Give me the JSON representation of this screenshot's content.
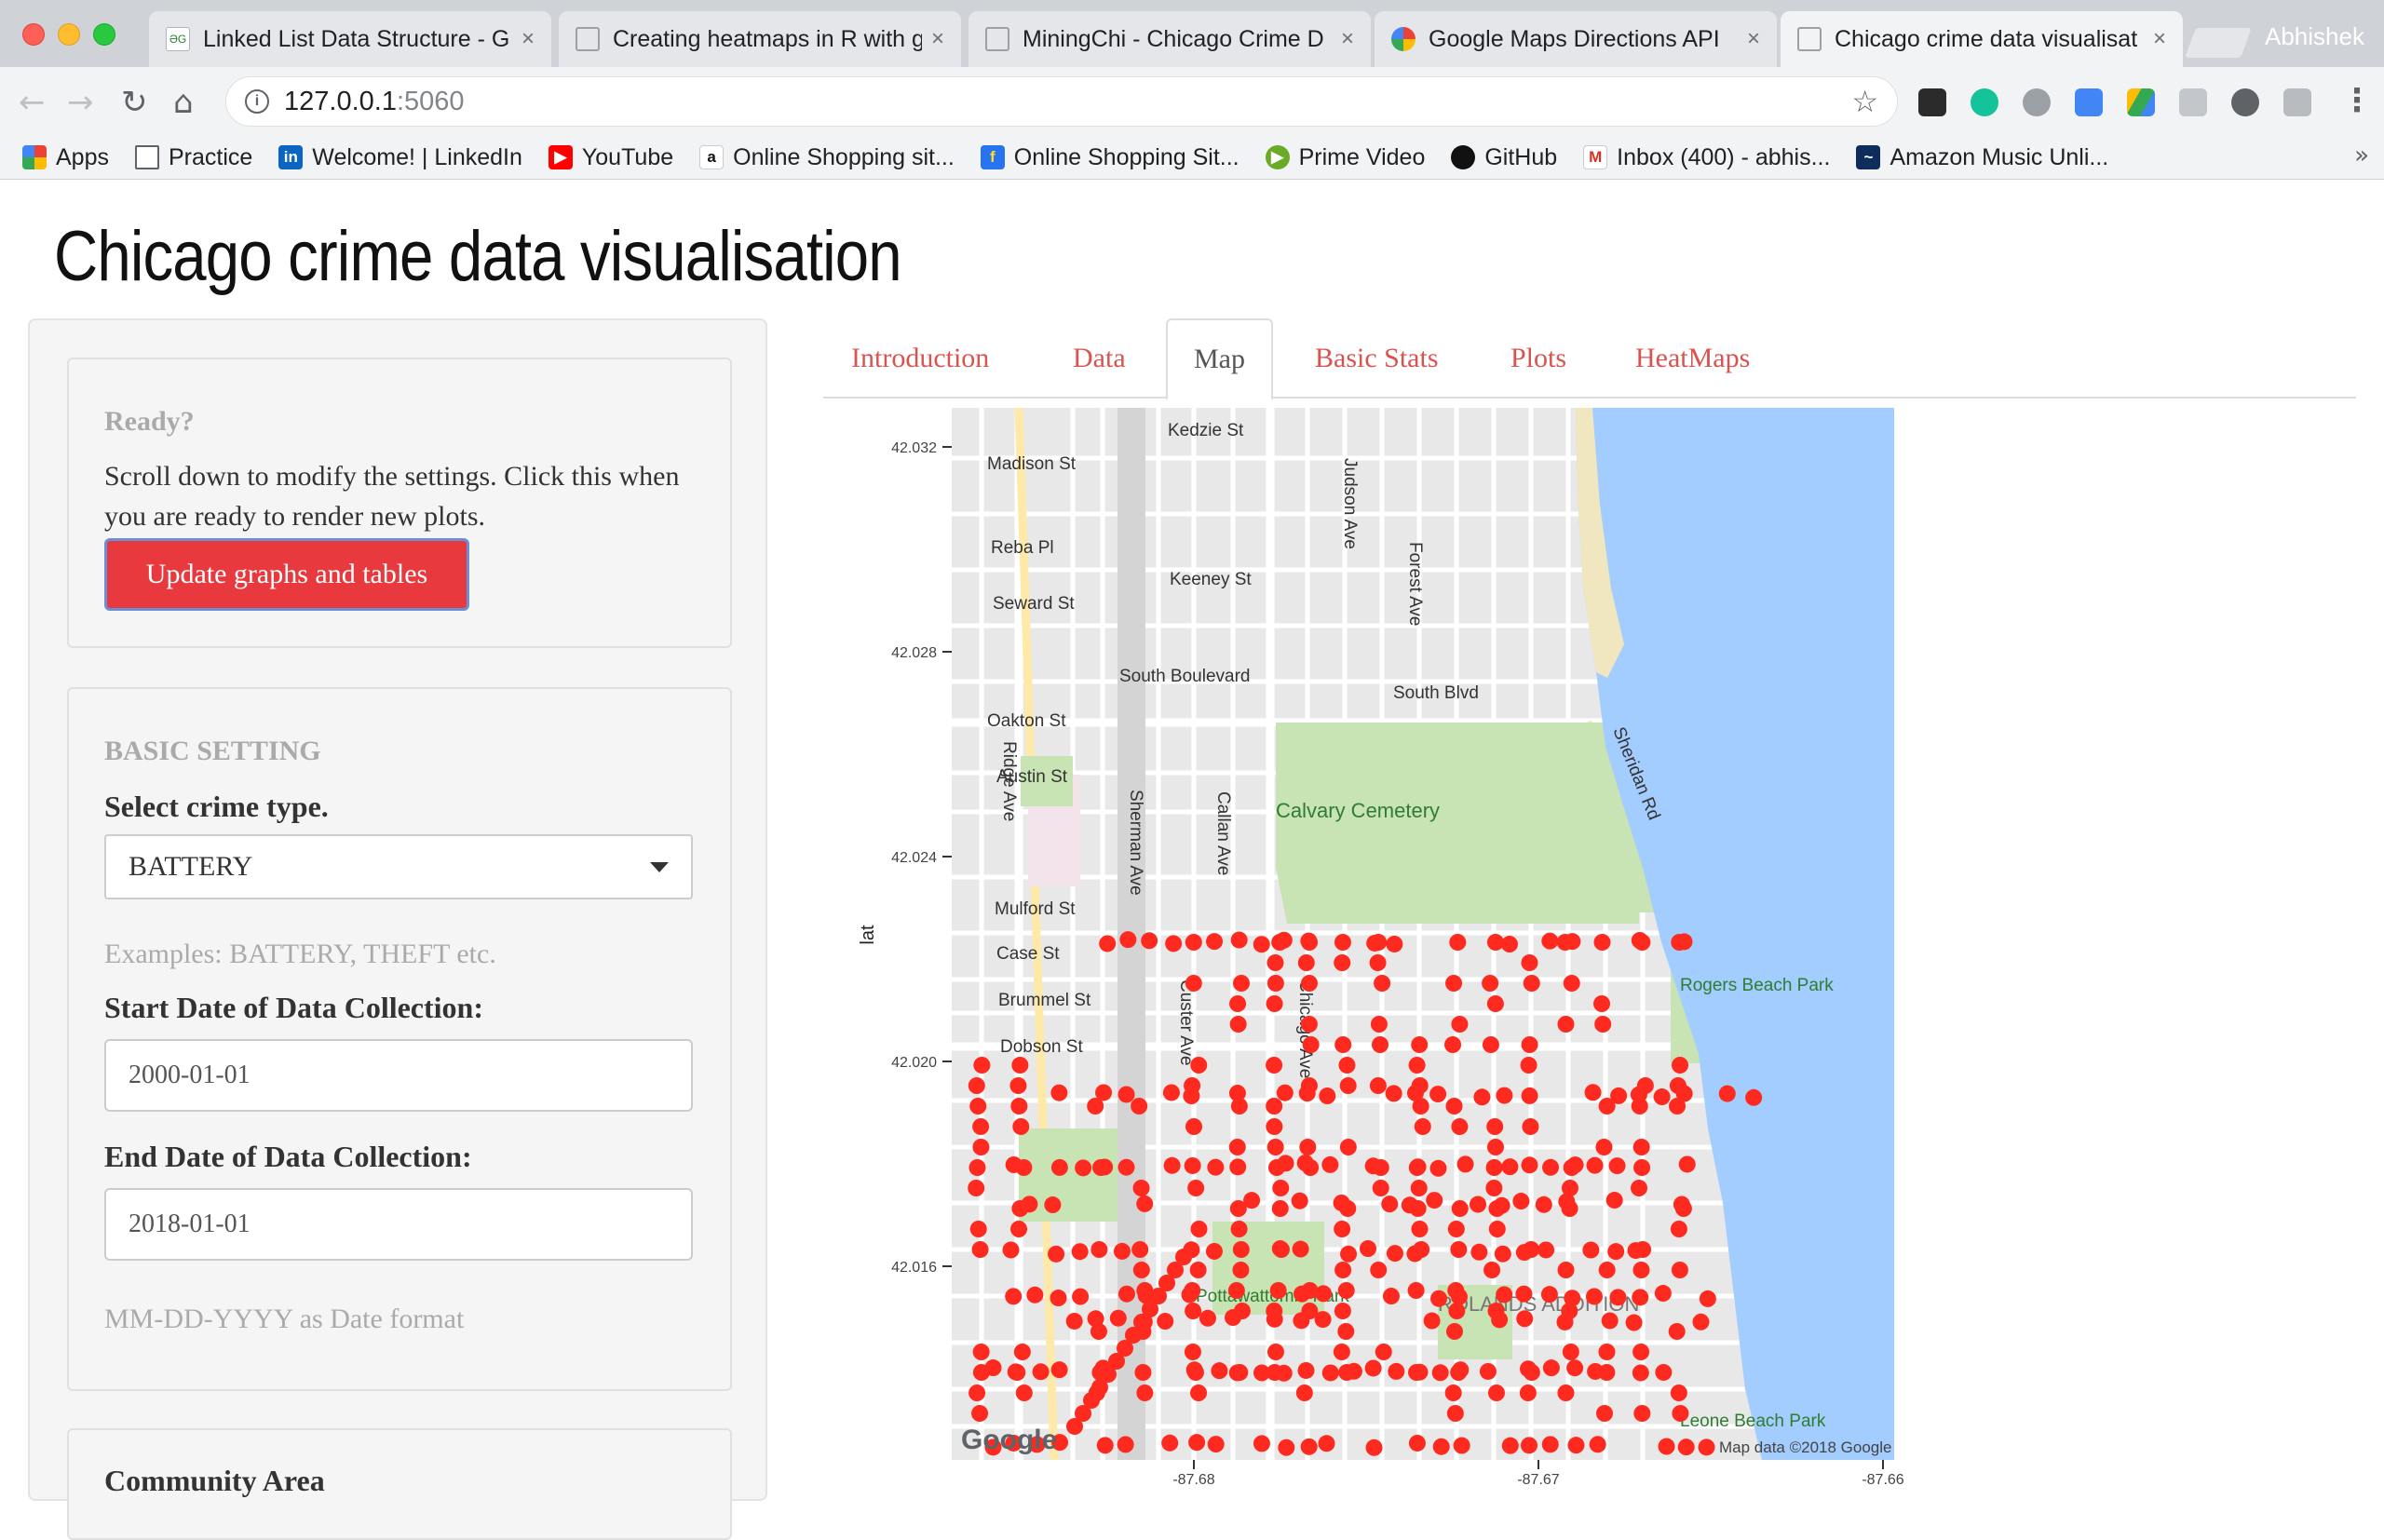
{
  "browser": {
    "tabs": [
      {
        "title": "Linked List Data Structure - G",
        "icon": "geeksforgeeks-favicon"
      },
      {
        "title": "Creating heatmaps in R with gg",
        "icon": "doc-favicon"
      },
      {
        "title": "MiningChi - Chicago Crime D",
        "icon": "doc-favicon"
      },
      {
        "title": "Google Maps Directions API",
        "icon": "google-favicon"
      },
      {
        "title": "Chicago crime data visualisat",
        "icon": "doc-favicon",
        "active": true
      }
    ],
    "profile": "Abhishek",
    "url_host": "127.0.0.1",
    "url_port": ":5060",
    "bookmarks": [
      {
        "label": "Apps",
        "icon": "apps-grid-icon"
      },
      {
        "label": "Practice",
        "icon": "folder-icon"
      },
      {
        "label": "Welcome! | LinkedIn",
        "icon": "linkedin-icon"
      },
      {
        "label": "YouTube",
        "icon": "youtube-icon"
      },
      {
        "label": "Online Shopping sit...",
        "icon": "amazon-icon"
      },
      {
        "label": "Online Shopping Sit...",
        "icon": "flipkart-icon"
      },
      {
        "label": "Prime Video",
        "icon": "prime-video-icon"
      },
      {
        "label": "GitHub",
        "icon": "github-icon"
      },
      {
        "label": "Inbox (400) - abhis...",
        "icon": "gmail-icon"
      },
      {
        "label": "Amazon Music Unli...",
        "icon": "amazon-music-icon"
      }
    ]
  },
  "page": {
    "title": "Chicago crime data visualisation"
  },
  "sidebar": {
    "ready_heading": "Ready?",
    "ready_text": "Scroll down to modify the settings. Click this when you are ready to render new plots.",
    "update_button": "Update graphs and tables",
    "basic_heading": "BASIC SETTING",
    "crime_label": "Select crime type.",
    "crime_value": "BATTERY",
    "crime_hint": "Examples: BATTERY, THEFT etc.",
    "start_label": "Start Date of Data Collection:",
    "start_value": "2000-01-01",
    "end_label": "End Date of Data Collection:",
    "end_value": "2018-01-01",
    "date_hint": "MM-DD-YYYY as Date format",
    "community_heading": "Community Area"
  },
  "tabs": [
    "Introduction",
    "Data",
    "Map",
    "Basic Stats",
    "Plots",
    "HeatMaps"
  ],
  "active_tab": "Map",
  "map": {
    "y_axis_label": "lat",
    "y_ticks": [
      "42.032",
      "42.028",
      "42.024",
      "42.020",
      "42.016"
    ],
    "x_ticks": [
      "-87.68",
      "-87.67",
      "-87.66"
    ],
    "attribution": "Map data ©2018 Google",
    "google_logo": "Google",
    "streets": [
      "Madison St",
      "Kedzie St",
      "Reba Pl",
      "Keeney St",
      "Seward St",
      "South Boulevard",
      "South Blvd",
      "Oakton St",
      "Austin St",
      "Calvary Cemetery",
      "Mulford St",
      "Case St",
      "Brummel St",
      "Dobson St",
      "Sheridan Rd",
      "Rogers Beach Park",
      "Pottawattomie Park",
      "ROLANDS ADDITION",
      "Leone Beach Park",
      "Forest Ave",
      "Judson Ave",
      "Sherman Ave",
      "Callan Ave",
      "Chicago Ave",
      "Ridge Ave",
      "Custer Ave"
    ],
    "point_color": "#ff2a1f",
    "water_color": "#a3ccff",
    "park_color": "#c9e4b4"
  }
}
